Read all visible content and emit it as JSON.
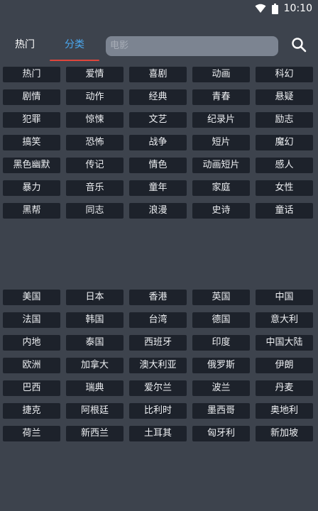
{
  "status": {
    "time": "10:10"
  },
  "tabs": {
    "hot": "热门",
    "category": "分类"
  },
  "search": {
    "placeholder": "电影"
  },
  "genres": [
    "热门",
    "爱情",
    "喜剧",
    "动画",
    "科幻",
    "剧情",
    "动作",
    "经典",
    "青春",
    "悬疑",
    "犯罪",
    "惊悚",
    "文艺",
    "纪录片",
    "励志",
    "搞笑",
    "恐怖",
    "战争",
    "短片",
    "魔幻",
    "黑色幽默",
    "传记",
    "情色",
    "动画短片",
    "感人",
    "暴力",
    "音乐",
    "童年",
    "家庭",
    "女性",
    "黑帮",
    "同志",
    "浪漫",
    "史诗",
    "童话"
  ],
  "regions": [
    "美国",
    "日本",
    "香港",
    "英国",
    "中国",
    "法国",
    "韩国",
    "台湾",
    "德国",
    "意大利",
    "内地",
    "泰国",
    "西班牙",
    "印度",
    "中国大陆",
    "欧洲",
    "加拿大",
    "澳大利亚",
    "俄罗斯",
    "伊朗",
    "巴西",
    "瑞典",
    "爱尔兰",
    "波兰",
    "丹麦",
    "捷克",
    "阿根廷",
    "比利时",
    "墨西哥",
    "奥地利",
    "荷兰",
    "新西兰",
    "土耳其",
    "匈牙利",
    "新加坡"
  ]
}
